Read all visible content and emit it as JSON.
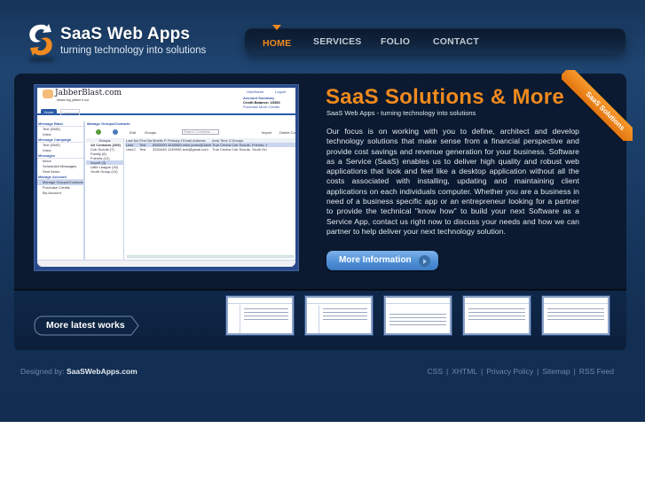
{
  "header": {
    "site_title": "SaaS Web Apps",
    "tagline": "turning technology into solutions"
  },
  "nav": {
    "items": [
      {
        "label": "HOME",
        "active": true
      },
      {
        "label": "SERVICES",
        "active": false
      },
      {
        "label": "FOLIO",
        "active": false
      },
      {
        "label": "CONTACT",
        "active": false
      }
    ]
  },
  "hero": {
    "ribbon": "SaaS Solutions",
    "headline": "SaaS Solutions & More",
    "subhead": "SaaS Web Apps - turning technology into solutions",
    "body": "Our focus is on working with you to define, architect and develop technology solutions that make sense from a financial perspective and provide cost savings and revenue generation for your business.  Software as a Service (SaaS) enables us to deliver high quality and robust web applications that look and feel like a desktop application without all the costs associated with installing, updating and maintaining client applications on each individuals computer.  Whether you are a business in need of a business specific app or an entrepreneur looking for a partner to provide the technical \"know how\" to build your next Software as a Service App, contact us right now to discuss your needs and how we can partner to help deliver your next technology solution.",
    "button_label": "More Information",
    "screenshot": {
      "app_name": "JabberBlast.com",
      "app_tagline": "dream big, jabber it out",
      "top_links": [
        "UserName",
        "Logout"
      ],
      "account_title": "Account Summary",
      "credit_balance": "Credit Balance: 15353",
      "purchase_link": "Purchase More Credits",
      "tabs": [
        "Home",
        "Contact Us"
      ],
      "panel_title": "Manage Groups/Contacts",
      "sidebar": [
        {
          "label": "Message Blast",
          "heading": true
        },
        {
          "label": "Text (SMS)"
        },
        {
          "label": "Voice"
        },
        {
          "label": "Message Campaign",
          "heading": true
        },
        {
          "label": "Text (SMS)"
        },
        {
          "label": "Voice"
        },
        {
          "label": "Messages",
          "heading": true
        },
        {
          "label": "Inbox"
        },
        {
          "label": "Scheduled Messages"
        },
        {
          "label": "Sent Items"
        },
        {
          "label": "Manage Account",
          "heading": true
        },
        {
          "label": "Manage Groups/Contacts",
          "selected": true
        },
        {
          "label": "Purchase Credits"
        },
        {
          "label": "My Account"
        }
      ],
      "toolbar": [
        "Edit",
        "Groups",
        "Search Contacts...",
        "Import",
        "Delete Contact"
      ],
      "groups_header": "Groups",
      "groups": [
        "All Contacts (205)",
        "Cub Scouts (7)",
        "Family (6)",
        "Friends (12)",
        "Import (3)",
        "Little League (30)",
        "Youth Group (10)"
      ],
      "columns": [
        "Last Name",
        "First Name",
        "Mobile Phone",
        "Primary Phone",
        "Email Address",
        "Active",
        "Time Zone",
        "Groups"
      ],
      "rows": [
        [
          "User",
          "Test",
          "5550000000",
          "4445550000",
          "mike.jones@JabberBlast.com",
          "True",
          "Central",
          "Cub Scouts, Friends, Import"
        ],
        [
          "User2",
          "Test",
          "3334445555",
          "1139992222",
          "test@gmail.com",
          "True",
          "Central",
          "Cub Scouts, Youth Group, Lit"
        ]
      ]
    }
  },
  "works": {
    "button_label": "More latest works",
    "thumbnails": 5
  },
  "footer": {
    "designed_by_prefix": "Designed by:",
    "designed_by_name": "SaaSWebApps.com",
    "links": [
      "CSS",
      "XHTML",
      "Privacy Policy",
      "Sitemap",
      "RSS Feed"
    ]
  },
  "colors": {
    "accent_orange": "#f08a1e",
    "button_blue": "#4f8fd6",
    "panel_dark": "#0b1a30",
    "page_blue": "#173459"
  }
}
